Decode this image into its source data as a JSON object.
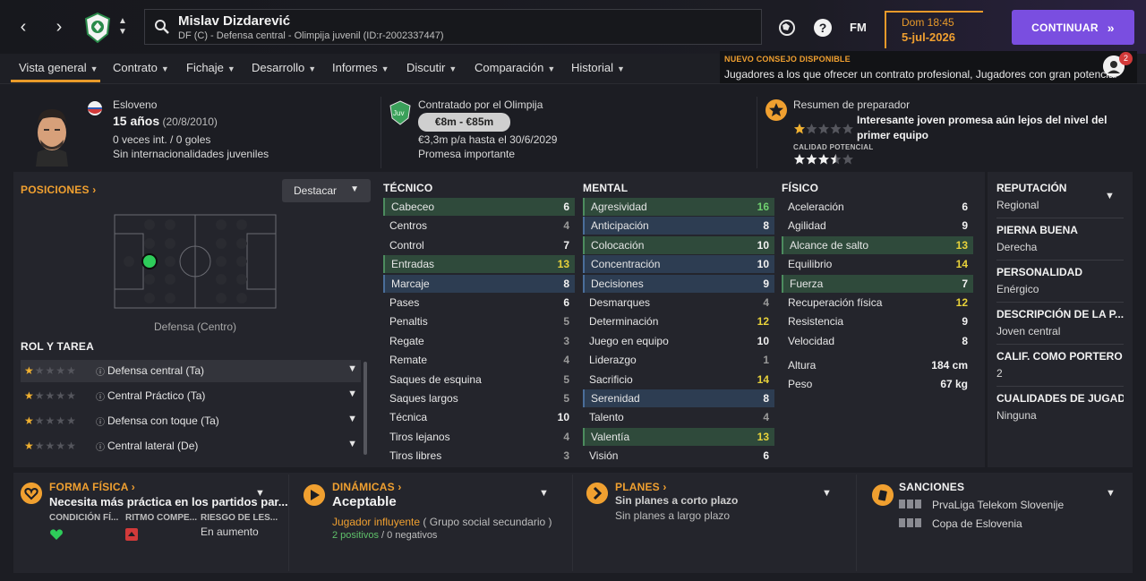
{
  "topbar": {
    "player_name": "Mislav Dizdarević",
    "player_sub": "DF (C) - Defensa central - Olimpija juvenil (ID:r-2002337447)",
    "fm_label": "FM",
    "day_time": "Dom 18:45",
    "date": "5-jul-2026",
    "continue_label": "CONTINUAR",
    "advice_title": "NUEVO CONSEJO DISPONIBLE",
    "advice_text": "Jugadores a los que ofrecer un contrato profesional, Jugadores con gran potencial",
    "advice_count": "2"
  },
  "tabs": [
    "Vista general",
    "Contrato",
    "Fichaje",
    "Desarrollo",
    "Informes",
    "Discutir",
    "Comparación",
    "Historial"
  ],
  "bio": {
    "nationality": "Esloveno",
    "age": "15 años",
    "dob": "(20/8/2010)",
    "caps": "0 veces int. / 0 goles",
    "youth_caps": "Sin internacionalidades juveniles"
  },
  "contract": {
    "badge": "Juv",
    "contracted_by": "Contratado por el Olimpija",
    "value": "€8m - €85m",
    "wage": "€3,3m p/a hasta el 30/6/2029",
    "status": "Promesa importante"
  },
  "coach": {
    "title": "Resumen de preparador",
    "summary": "Interesante joven promesa aún lejos del nivel del primer equipo",
    "potential_label": "CALIDAD POTENCIAL",
    "current_stars": 1,
    "potential_stars": 3.5
  },
  "positions": {
    "title": "POSICIONES",
    "highlight_label": "Destacar",
    "position_label": "Defensa (Centro)"
  },
  "roles": {
    "title": "ROL Y TAREA",
    "items": [
      {
        "name": "Defensa central (Ta)",
        "stars": 1
      },
      {
        "name": "Central Práctico (Ta)",
        "stars": 1
      },
      {
        "name": "Defensa con toque (Ta)",
        "stars": 1
      },
      {
        "name": "Central lateral (De)",
        "stars": 1
      }
    ]
  },
  "attributes": {
    "tecnico_title": "TÉCNICO",
    "mental_title": "MENTAL",
    "fisico_title": "FÍSICO",
    "tecnico": [
      {
        "name": "Cabeceo",
        "value": "6",
        "hl": "green"
      },
      {
        "name": "Centros",
        "value": "4",
        "hl": ""
      },
      {
        "name": "Control",
        "value": "7",
        "hl": ""
      },
      {
        "name": "Entradas",
        "value": "13",
        "hl": "green"
      },
      {
        "name": "Marcaje",
        "value": "8",
        "hl": "blue"
      },
      {
        "name": "Pases",
        "value": "6",
        "hl": ""
      },
      {
        "name": "Penaltis",
        "value": "5",
        "hl": ""
      },
      {
        "name": "Regate",
        "value": "3",
        "hl": ""
      },
      {
        "name": "Remate",
        "value": "4",
        "hl": ""
      },
      {
        "name": "Saques de esquina",
        "value": "5",
        "hl": ""
      },
      {
        "name": "Saques largos",
        "value": "5",
        "hl": ""
      },
      {
        "name": "Técnica",
        "value": "10",
        "hl": ""
      },
      {
        "name": "Tiros lejanos",
        "value": "4",
        "hl": ""
      },
      {
        "name": "Tiros libres",
        "value": "3",
        "hl": ""
      }
    ],
    "mental": [
      {
        "name": "Agresividad",
        "value": "16",
        "hl": "green"
      },
      {
        "name": "Anticipación",
        "value": "8",
        "hl": "blue"
      },
      {
        "name": "Colocación",
        "value": "10",
        "hl": "green"
      },
      {
        "name": "Concentración",
        "value": "10",
        "hl": "blue"
      },
      {
        "name": "Decisiones",
        "value": "9",
        "hl": "blue"
      },
      {
        "name": "Desmarques",
        "value": "4",
        "hl": ""
      },
      {
        "name": "Determinación",
        "value": "12",
        "hl": ""
      },
      {
        "name": "Juego en equipo",
        "value": "10",
        "hl": ""
      },
      {
        "name": "Liderazgo",
        "value": "1",
        "hl": ""
      },
      {
        "name": "Sacrificio",
        "value": "14",
        "hl": ""
      },
      {
        "name": "Serenidad",
        "value": "8",
        "hl": "blue"
      },
      {
        "name": "Talento",
        "value": "4",
        "hl": ""
      },
      {
        "name": "Valentía",
        "value": "13",
        "hl": "green"
      },
      {
        "name": "Visión",
        "value": "6",
        "hl": ""
      }
    ],
    "fisico": [
      {
        "name": "Aceleración",
        "value": "6",
        "hl": ""
      },
      {
        "name": "Agilidad",
        "value": "9",
        "hl": ""
      },
      {
        "name": "Alcance de salto",
        "value": "13",
        "hl": "green"
      },
      {
        "name": "Equilibrio",
        "value": "14",
        "hl": ""
      },
      {
        "name": "Fuerza",
        "value": "7",
        "hl": "green"
      },
      {
        "name": "Recuperación física",
        "value": "12",
        "hl": ""
      },
      {
        "name": "Resistencia",
        "value": "9",
        "hl": ""
      },
      {
        "name": "Velocidad",
        "value": "8",
        "hl": ""
      }
    ],
    "height_label": "Altura",
    "height": "184 cm",
    "weight_label": "Peso",
    "weight": "67 kg"
  },
  "side": [
    {
      "title": "REPUTACIÓN",
      "value": "Regional"
    },
    {
      "title": "PIERNA BUENA",
      "value": "Derecha"
    },
    {
      "title": "PERSONALIDAD",
      "value": "Enérgico"
    },
    {
      "title": "DESCRIPCIÓN DE LA P...",
      "value": "Joven central"
    },
    {
      "title": "CALIF. COMO PORTERO",
      "value": "2"
    },
    {
      "title": "CUALIDADES DE JUGADO",
      "value": "Ninguna"
    }
  ],
  "bottom": {
    "form_title": "FORMA FÍSICA",
    "form_text": "Necesita más práctica en los partidos par...",
    "form_cols": [
      "CONDICIÓN FÍ...",
      "RITMO COMPE...",
      "RIESGO DE LES..."
    ],
    "form_risk": "En aumento",
    "dyn_title": "DINÁMICAS",
    "dyn_value": "Aceptable",
    "dyn_role": "Jugador influyente",
    "dyn_group": "( Grupo social secundario )",
    "dyn_pos": "2 positivos",
    "dyn_sep": "/",
    "dyn_neg": "0 negativos",
    "plans_title": "PLANES",
    "plans_short": "Sin planes a corto plazo",
    "plans_long": "Sin planes a largo plazo",
    "sanc_title": "SANCIONES",
    "sanc_1": "PrvaLiga Telekom Slovenije",
    "sanc_2": "Copa de Eslovenia"
  },
  "colors": {
    "accent": "#f0a030",
    "button": "#7a4ee0",
    "value_white": "#f2f2f2",
    "value_yellow": "#e8d23a",
    "value_green": "#6fd06f",
    "value_grey": "#9a9a9a"
  }
}
